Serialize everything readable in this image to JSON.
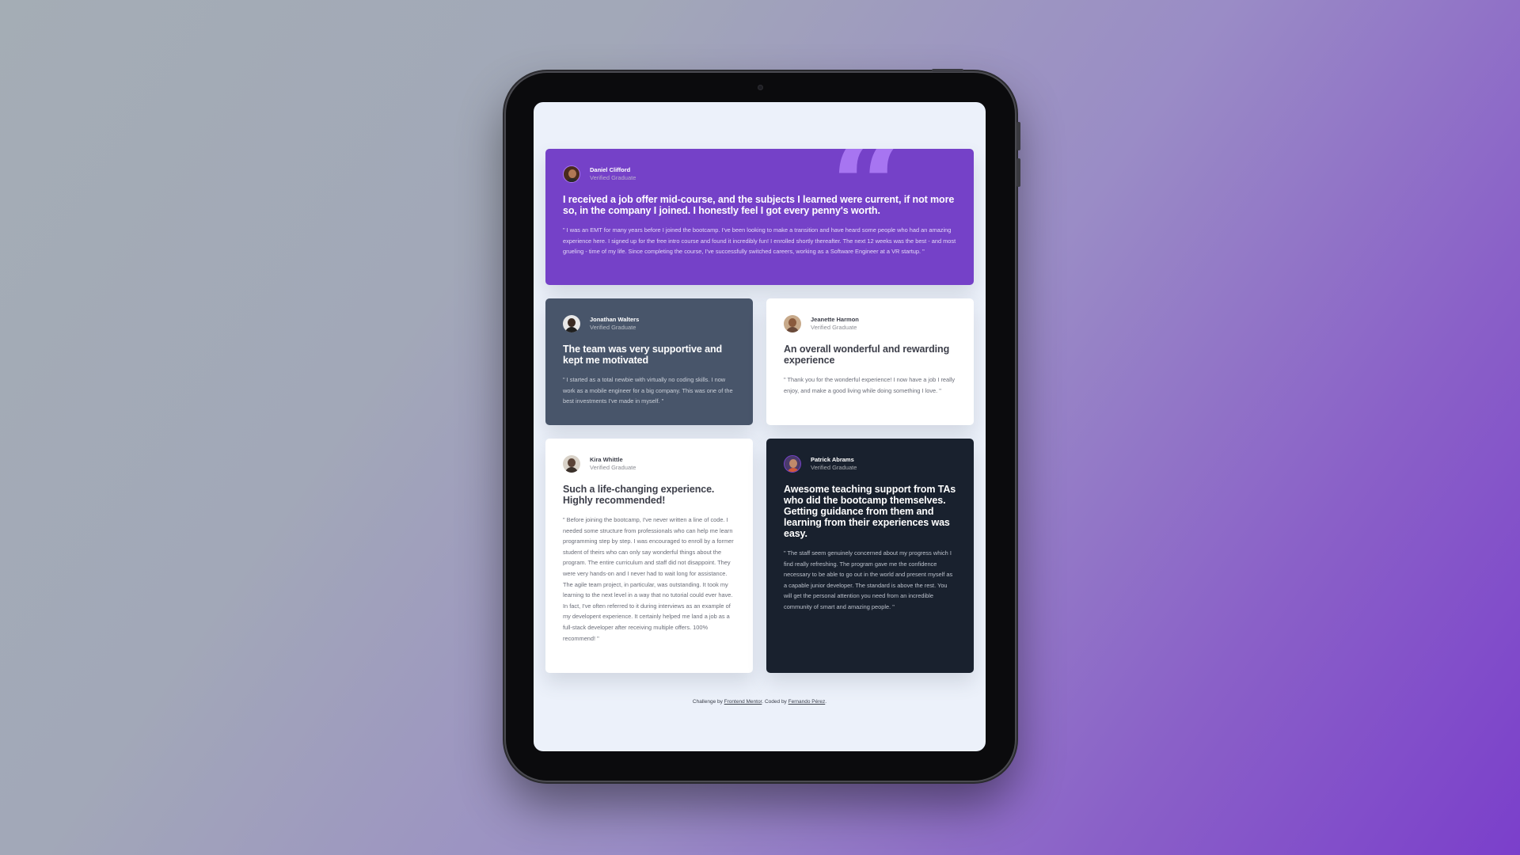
{
  "colors": {
    "purple": "#7541c8",
    "grayish_blue": "#48556a",
    "dark_blackish_blue": "#19212e",
    "white": "#ffffff",
    "light_gray_bg": "#ecf1fa"
  },
  "testimonials": [
    {
      "name": "Daniel Clifford",
      "role": "Verified Graduate",
      "headline": "I received a job offer mid-course, and the subjects I learned were current, if not more so, in the company I joined. I honestly feel I got every penny's worth.",
      "quote": "\" I was an EMT for many years before I joined the bootcamp. I've been looking to make a transition and have heard some people who had an amazing experience here. I signed up for the free intro course and found it incredibly fun! I enrolled shortly thereafter. The next 12 weeks was the best - and most grueling - time of my life. Since completing the course, I've successfully switched careers, working as a Software Engineer at a VR startup. \""
    },
    {
      "name": "Jonathan Walters",
      "role": "Verified Graduate",
      "headline": "The team was very supportive and kept me motivated",
      "quote": "\" I started as a total newbie with virtually no coding skills. I now work as a mobile engineer for a big company. This was one of the best investments I've made in myself. \""
    },
    {
      "name": "Jeanette Harmon",
      "role": "Verified Graduate",
      "headline": "An overall wonderful and rewarding experience",
      "quote": "\" Thank you for the wonderful experience! I now have a job I really enjoy, and make a good living while doing something I love. \""
    },
    {
      "name": "Kira Whittle",
      "role": "Verified Graduate",
      "headline": "Such a life-changing experience. Highly recommended!",
      "quote": "\" Before joining the bootcamp, I've never written a line of code. I needed some structure from professionals who can help me learn programming step by step. I was encouraged to enroll by a former student of theirs who can only say wonderful things about the program. The entire curriculum and staff did not disappoint. They were very hands-on and I never had to wait long for assistance. The agile team project, in particular, was outstanding. It took my learning to the next level in a way that no tutorial could ever have. In fact, I've often referred to it during interviews as an example of my developent experience. It certainly helped me land a job as a full-stack developer after receiving multiple offers. 100% recommend! \""
    },
    {
      "name": "Patrick Abrams",
      "role": "Verified Graduate",
      "headline": "Awesome teaching support from TAs who did the bootcamp themselves. Getting guidance from them and learning from their experiences was easy.",
      "quote": "\" The staff seem genuinely concerned about my progress which I find really refreshing. The program gave me the confidence necessary to be able to go out in the world and present myself as a capable junior developer. The standard is above the rest. You will get the personal attention you need from an incredible community of smart and amazing people. \""
    }
  ],
  "quote_mark": "“",
  "footer": {
    "prefix": "Challenge by ",
    "link1": "Frontend Mentor",
    "middle": ". Coded by ",
    "link2": "Fernando Pérez",
    "suffix": "."
  }
}
